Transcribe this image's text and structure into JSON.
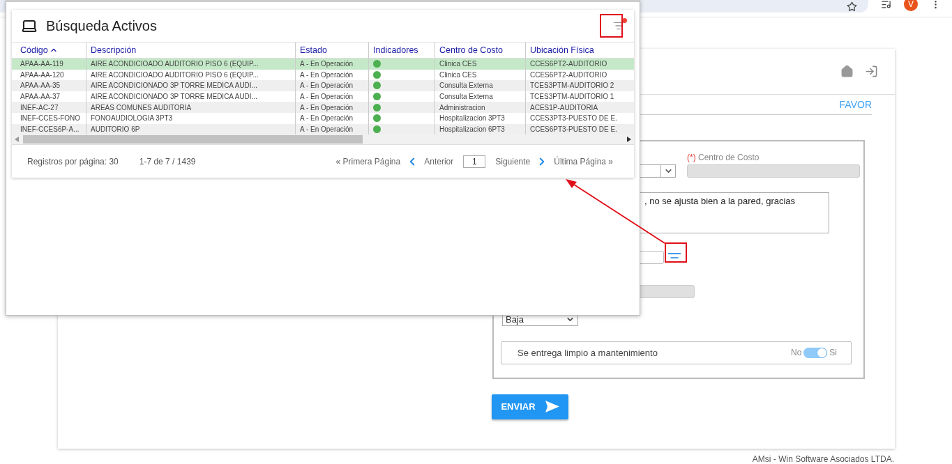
{
  "browser": {
    "avatar": "V"
  },
  "page": {
    "tab_label": "FAVOR",
    "center_cost": {
      "required_mark": "(*)",
      "label": "Centro de Costo"
    },
    "description": ", no se ajusta bien a la pared, gracias",
    "priority": "Baja",
    "toggle": {
      "label": "Se entrega limpio a mantenimiento",
      "off_label": "No",
      "on_label": "Si",
      "on": true
    },
    "submit": "ENVIAR",
    "footer": "AMsi - Win Software Asociados LTDA."
  },
  "dialog": {
    "title": "Búsqueda Activos",
    "filter_active": true,
    "columns": [
      {
        "label": "Código",
        "sorted": true
      },
      {
        "label": "Descripción",
        "sorted": false
      },
      {
        "label": "Estado",
        "sorted": false
      },
      {
        "label": "Indicadores",
        "sorted": false
      },
      {
        "label": "Centro de Costo",
        "sorted": false
      },
      {
        "label": "Ubicación Física",
        "sorted": false
      }
    ],
    "rows": [
      {
        "selected": true,
        "codigo": "APAA-AA-119",
        "descripcion": "AIRE ACONDICIOADO AUDITORIO PISO 6 (EQUIP...",
        "estado": "A - En Operación",
        "color": "#4caf50",
        "centro": "Clinica CES",
        "ubicacion": "CCES6PT2-AUDITORIO"
      },
      {
        "selected": false,
        "codigo": "APAA-AA-120",
        "descripcion": "AIRE ACONDICIOADO AUDITORIO PISO 6 (EQUIP...",
        "estado": "A - En Operación",
        "color": "#4caf50",
        "centro": "Clinica CES",
        "ubicacion": "CCES6PT2-AUDITORIO"
      },
      {
        "selected": false,
        "codigo": "APAA-AA-35",
        "descripcion": "AIRE ACONDICIONADO 3P TORRE MEDICA AUDI...",
        "estado": "A - En Operación",
        "color": "#4caf50",
        "centro": "Consulta Externa",
        "ubicacion": "TCES3PTM-AUDITORIO 2"
      },
      {
        "selected": false,
        "codigo": "APAA-AA-37",
        "descripcion": "AIRE ACONDICIONADO 3P TORRE MEDICA AUDI...",
        "estado": "A - En Operación",
        "color": "#4caf50",
        "centro": "Consulta Externa",
        "ubicacion": "TCES3PTM-AUDITORIO 1"
      },
      {
        "selected": false,
        "codigo": "INEF-AC-27",
        "descripcion": "AREAS COMUNES AUDITORIA",
        "estado": "A - En Operación",
        "color": "#4caf50",
        "centro": "Administracion",
        "ubicacion": "ACES1P-AUDITORIA"
      },
      {
        "selected": false,
        "codigo": "INEF-CCES-FONO",
        "descripcion": "FONOAUDIOLOGIA 3PT3",
        "estado": "A - En Operación",
        "color": "#4caf50",
        "centro": "Hospitalizacion 3PT3",
        "ubicacion": "CCES3PT3-PUESTO DE E."
      },
      {
        "selected": false,
        "codigo": "INEF-CCES6P-A...",
        "descripcion": "AUDITORIO 6P",
        "estado": "A - En Operación",
        "color": "#4caf50",
        "centro": "Hospitalizacion 6PT3",
        "ubicacion": "CCES6PT3-PUESTO DE E."
      }
    ],
    "pager": {
      "per_page": "Registros por página: 30",
      "range": "1-7 de 7 / 1439",
      "first": "« Primera Página",
      "prev": "Anterior",
      "page": "1",
      "next": "Siguiente",
      "last": "Última Página »"
    }
  }
}
